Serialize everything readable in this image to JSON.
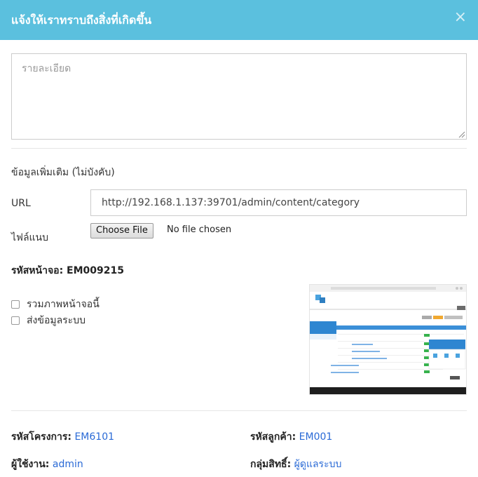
{
  "modal": {
    "title": "แจ้งให้เราทราบถึงสิ่งที่เกิดขึ้น",
    "close_glyph": "×"
  },
  "details": {
    "placeholder": "รายละเอียด"
  },
  "extra": {
    "section_label": "ข้อมูลเพิ่มเติม (ไม่บังคับ)",
    "url_label": "URL",
    "url_value": "http://192.168.1.137:39701/admin/content/category",
    "file_label": "ไฟล์แนบ",
    "file_button": "Choose File",
    "file_status": "No file chosen"
  },
  "screen": {
    "code_text": "รหัสหน้าจอ: EM009215"
  },
  "options": {
    "include_screenshot": "รวมภาพหน้าจอนี้",
    "send_system_info": "ส่งข้อมูลระบบ"
  },
  "info": {
    "project_label": "รหัสโครงการ:",
    "project_value": "EM6101",
    "customer_label": "รหัสลูกค้า:",
    "customer_value": "EM001",
    "user_label": "ผู้ใช้งาน:",
    "user_value": "admin",
    "group_label": "กลุ่มสิทธิ์:",
    "group_value": "ผู้ดูแลระบบ"
  },
  "colors": {
    "header": "#5bc0de",
    "link": "#2a6ad6"
  }
}
